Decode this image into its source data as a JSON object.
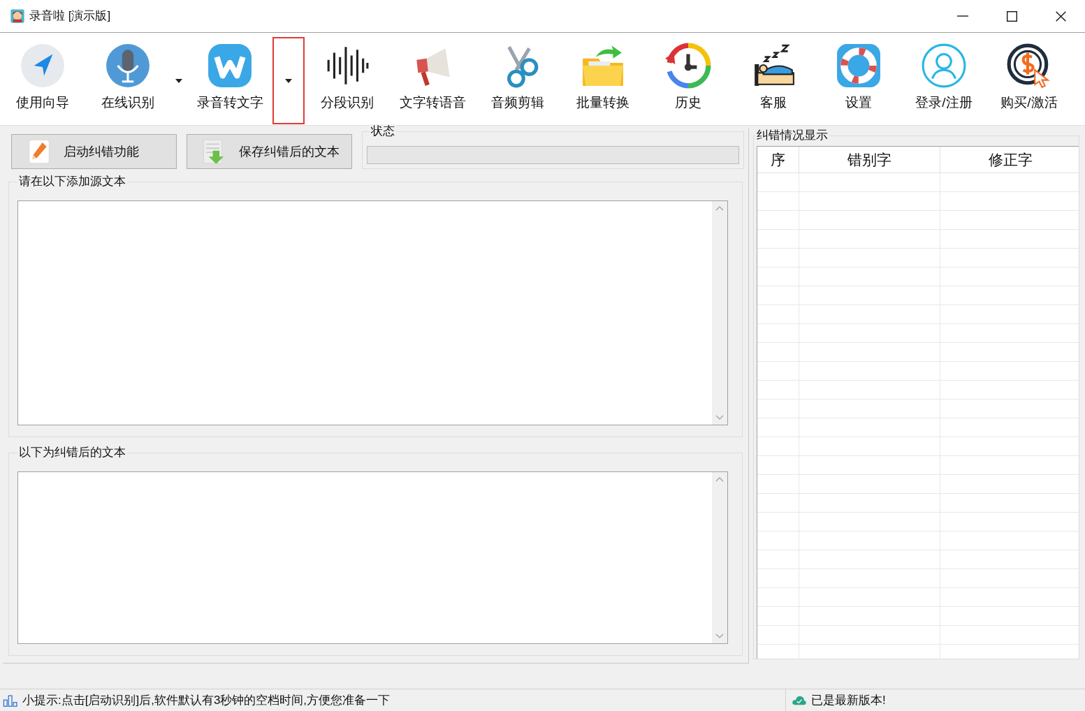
{
  "window": {
    "title": "录音啦 [演示版]"
  },
  "toolbar": [
    {
      "label": "使用向导"
    },
    {
      "label": "在线识别",
      "dropdown": {
        "highlighted": false
      }
    },
    {
      "label": "录音转文字",
      "dropdown": {
        "highlighted": true
      }
    },
    {
      "label": "分段识别"
    },
    {
      "label": "文字转语音"
    },
    {
      "label": "音频剪辑"
    },
    {
      "label": "批量转换"
    },
    {
      "label": "历史"
    },
    {
      "label": "客服"
    },
    {
      "label": "设置"
    },
    {
      "label": "登录/注册"
    },
    {
      "label": "购买/激活"
    }
  ],
  "actions": [
    {
      "label": "启动纠错功能"
    },
    {
      "label": "保存纠错后的文本"
    }
  ],
  "status_group": {
    "title": "状态",
    "level": 0
  },
  "source_group": {
    "title": "请在以下添加源文本"
  },
  "result_group": {
    "title": "以下为纠错后的文本"
  },
  "corrections": {
    "title": "纠错情况显示",
    "columns": [
      "序",
      "错别字",
      "修正字"
    ]
  },
  "status_bar": {
    "tip": "小提示:点击[启动识别]后,软件默认有3秒钟的空档时间,方便您准备一下",
    "version": "已是最新版本!"
  }
}
